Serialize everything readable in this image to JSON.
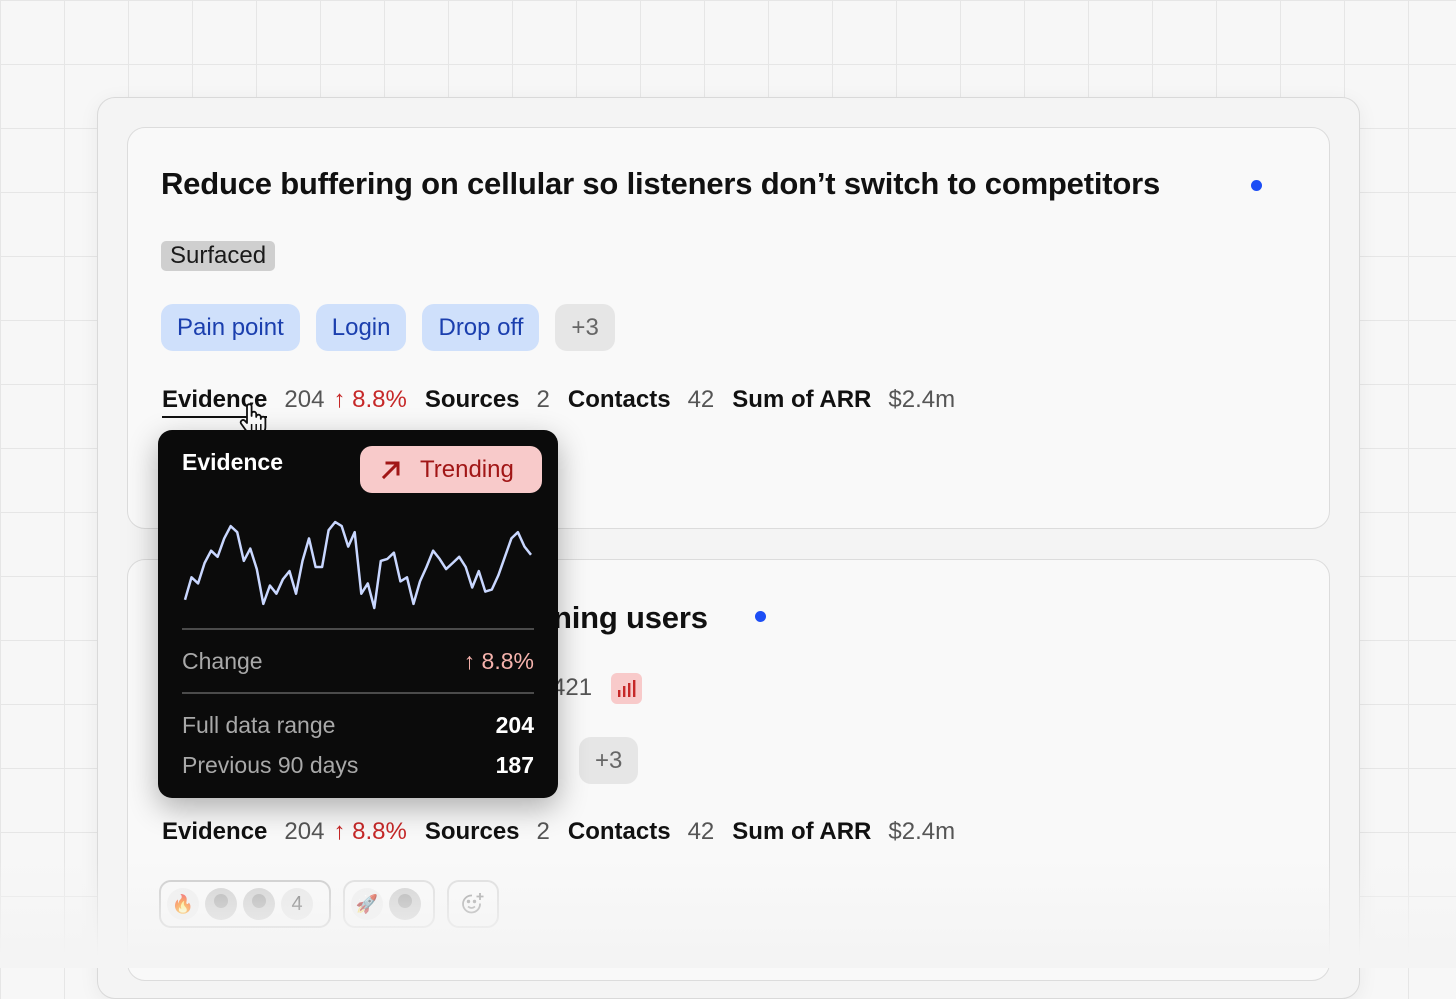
{
  "card1": {
    "title": "Reduce buffering on cellular so listeners don’t switch to competitors",
    "status": "Surfaced",
    "tags": [
      "Pain point",
      "Login",
      "Drop off"
    ],
    "more_tags": "+3",
    "metrics": {
      "evidence_label": "Evidence",
      "evidence_value": "204",
      "evidence_change": "↑ 8.8%",
      "sources_label": "Sources",
      "sources_value": "2",
      "contacts_label": "Contacts",
      "contacts_value": "42",
      "arr_label": "Sum of ARR",
      "arr_value": "$2.4m"
    }
  },
  "card2": {
    "title_visible": "ning users",
    "partial_value": "421",
    "more_tags": "+3",
    "metrics": {
      "evidence_label": "Evidence",
      "evidence_value": "204",
      "evidence_change": "↑ 8.8%",
      "sources_label": "Sources",
      "sources_value": "2",
      "contacts_label": "Contacts",
      "contacts_value": "42",
      "arr_label": "Sum of ARR",
      "arr_value": "$2.4m"
    },
    "reactions": [
      {
        "emoji": "🔥",
        "count": "4",
        "selected": true
      },
      {
        "emoji": "🚀",
        "selected": false
      }
    ]
  },
  "tooltip": {
    "title": "Evidence",
    "badge": "Trending",
    "change_label": "Change",
    "change_value": "↑ 8.8%",
    "full_range_label": "Full data range",
    "full_range_value": "204",
    "prev_label": "Previous 90 days",
    "prev_value": "187",
    "sparkline": [
      38,
      27,
      30,
      20,
      14,
      17,
      8,
      2,
      5,
      19,
      13,
      23,
      40,
      31,
      35,
      28,
      24,
      35,
      19,
      8,
      22,
      22,
      4,
      0,
      2,
      12,
      5,
      35,
      30,
      42,
      19,
      18,
      15,
      29,
      27,
      40,
      29,
      22,
      14,
      18,
      23,
      20,
      17,
      22,
      32,
      24,
      34,
      33,
      26,
      17,
      8,
      5,
      12,
      16
    ],
    "colors": {
      "line": "#c9d7ff",
      "badge_bg": "#f8caca",
      "badge_text": "#a11616"
    }
  },
  "colors": {
    "accent_dot": "#1d4ef5",
    "tag_bg": "#cfe0fb",
    "tag_text": "#1b3fae",
    "change_red": "#c62828"
  }
}
